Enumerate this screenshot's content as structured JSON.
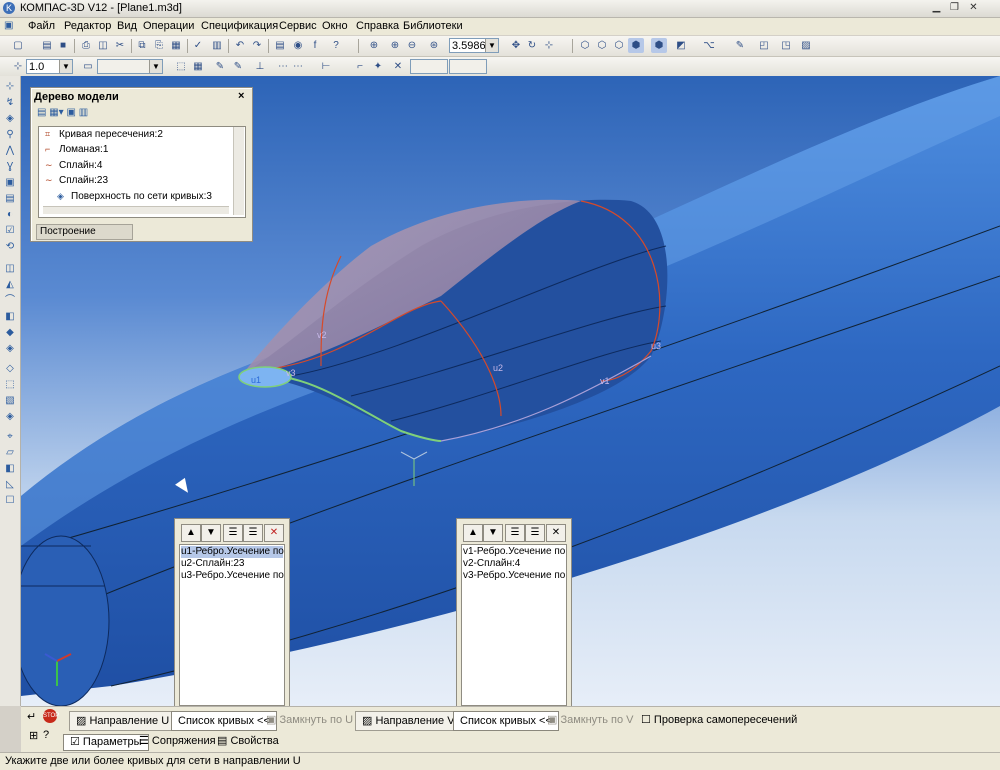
{
  "window": {
    "title": "КОМПАС-3D V12 - [Plane1.m3d]",
    "logo_glyph": "K"
  },
  "menu": [
    "Файл",
    "Редактор",
    "Вид",
    "Операции",
    "Спецификация",
    "Сервис",
    "Окно",
    "Справка",
    "Библиотеки"
  ],
  "toolbar1": {
    "zoom_value": "3.5986"
  },
  "toolbar2": {
    "scale_value": "1.0"
  },
  "tree": {
    "title": "Дерево модели",
    "close": "×",
    "items": [
      {
        "label": "Кривая пересечения:2",
        "icon": "intersection-curve-icon",
        "glyph": "⌗"
      },
      {
        "label": "Ломаная:1",
        "icon": "polyline-icon",
        "glyph": "⌐"
      },
      {
        "label": "Сплайн:4",
        "icon": "spline-icon",
        "glyph": "∼"
      },
      {
        "label": "Сплайн:23",
        "icon": "spline-icon",
        "glyph": "∼"
      },
      {
        "label": "Поверхность по сети кривых:3",
        "icon": "surface-icon",
        "glyph": "◈"
      }
    ],
    "tab": "Построение"
  },
  "curves_u": [
    "u1-Ребро.Усечение по",
    "u2-Сплайн:23",
    "u3-Ребро.Усечение по"
  ],
  "curves_v": [
    "v1-Ребро.Усечение по",
    "v2-Сплайн:4",
    "v3-Ребро.Усечение по"
  ],
  "labels3d": {
    "u1": "u1",
    "u2": "u2",
    "u3": "u3",
    "v1": "v1",
    "v2": "v2",
    "v3": "v3"
  },
  "props": {
    "dir_u": "Направление U",
    "curve_list": "Список кривых",
    "close_u": "Замкнуть по U",
    "dir_v": "Направление V",
    "close_v": "Замкнуть по V",
    "selfcheck": "Проверка самопересечений",
    "tab_params": "Параметры",
    "tab_links": "Сопряжения",
    "tab_props": "Свойства",
    "collapse": "<<"
  },
  "status": "Укажите две или более кривых для сети в направлении U"
}
